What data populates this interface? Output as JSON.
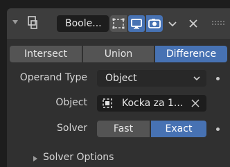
{
  "header": {
    "modifier_name": "Boole...",
    "icons": {
      "collapse": "collapse-arrow-icon",
      "modifier": "boolean-modifier-icon",
      "edit_mode": "edit-mode-icon",
      "viewport": "viewport-display-icon",
      "render": "render-icon",
      "menu": "chevron-down-icon",
      "close": "close-icon",
      "drag": "drag-handle-icon"
    }
  },
  "operation": {
    "options": [
      "Intersect",
      "Union",
      "Difference"
    ],
    "selected": "Difference"
  },
  "operand_type": {
    "label": "Operand Type",
    "value": "Object"
  },
  "object": {
    "label": "Object",
    "value": "Kocka za 1..."
  },
  "solver": {
    "label": "Solver",
    "options": [
      "Fast",
      "Exact"
    ],
    "selected": "Exact"
  },
  "subpanel": {
    "label": "Solver Options"
  },
  "colors": {
    "accent": "#4772b3",
    "panel": "#303030",
    "header": "#3d3d3d",
    "button": "#545454"
  }
}
